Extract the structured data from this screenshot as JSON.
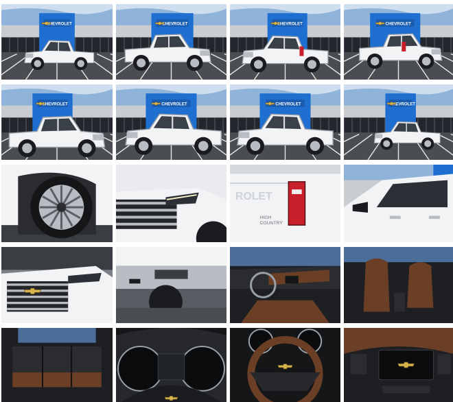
{
  "gallery": {
    "dealer_sign_text": "CHEVROLET",
    "tailgate_badge_text": "ROLET",
    "trim_badge_line1": "HIGH",
    "trim_badge_line2": "COUNTRY",
    "colors": {
      "sky": "#8fb3d9",
      "dealer_blue": "#1f6fd1",
      "building_gray": "#c9ccd1",
      "asphalt": "#4a4d52",
      "truck_white": "#f2f3f5",
      "chrome": "#b9bcc2",
      "taillight_red": "#c8202a",
      "interior_black": "#1e1f22",
      "interior_brown": "#6b3f26",
      "bowtie_gold": "#d8b24a"
    },
    "rows": [
      [
        {
          "name": "thumb-front-quarter-left",
          "view": "exterior-front-quarter-left"
        },
        {
          "name": "thumb-side-front-right",
          "view": "exterior-front-quarter-right"
        },
        {
          "name": "thumb-rear-quarter-left",
          "view": "exterior-rear-quarter-left"
        },
        {
          "name": "thumb-rear-quarter-right",
          "view": "exterior-rear-quarter-right"
        }
      ],
      [
        {
          "name": "thumb-side-profile",
          "view": "exterior-side-profile"
        },
        {
          "name": "thumb-front-low",
          "view": "exterior-front-low"
        },
        {
          "name": "thumb-front-three-quarter",
          "view": "exterior-front-three-quarter"
        },
        {
          "name": "thumb-front-distant",
          "view": "exterior-front-distant"
        }
      ],
      [
        {
          "name": "thumb-wheel-detail",
          "view": "detail-wheel"
        },
        {
          "name": "thumb-headlight-detail",
          "view": "detail-headlight"
        },
        {
          "name": "thumb-taillight-detail",
          "view": "detail-taillight"
        },
        {
          "name": "thumb-side-mirror-detail",
          "view": "detail-side-mirror"
        }
      ],
      [
        {
          "name": "thumb-grille-detail",
          "view": "detail-grille"
        },
        {
          "name": "thumb-rear-bumper-detail",
          "view": "detail-rear-bumper"
        },
        {
          "name": "thumb-dashboard-interior",
          "view": "interior-dashboard"
        },
        {
          "name": "thumb-front-seats-interior",
          "view": "interior-front-seats"
        }
      ],
      [
        {
          "name": "thumb-rear-seats-interior",
          "view": "interior-rear-seats"
        },
        {
          "name": "thumb-gauge-cluster",
          "view": "interior-gauge-cluster"
        },
        {
          "name": "thumb-steering-wheel",
          "view": "interior-steering-wheel"
        },
        {
          "name": "thumb-infotainment-screen",
          "view": "interior-infotainment"
        }
      ]
    ]
  }
}
